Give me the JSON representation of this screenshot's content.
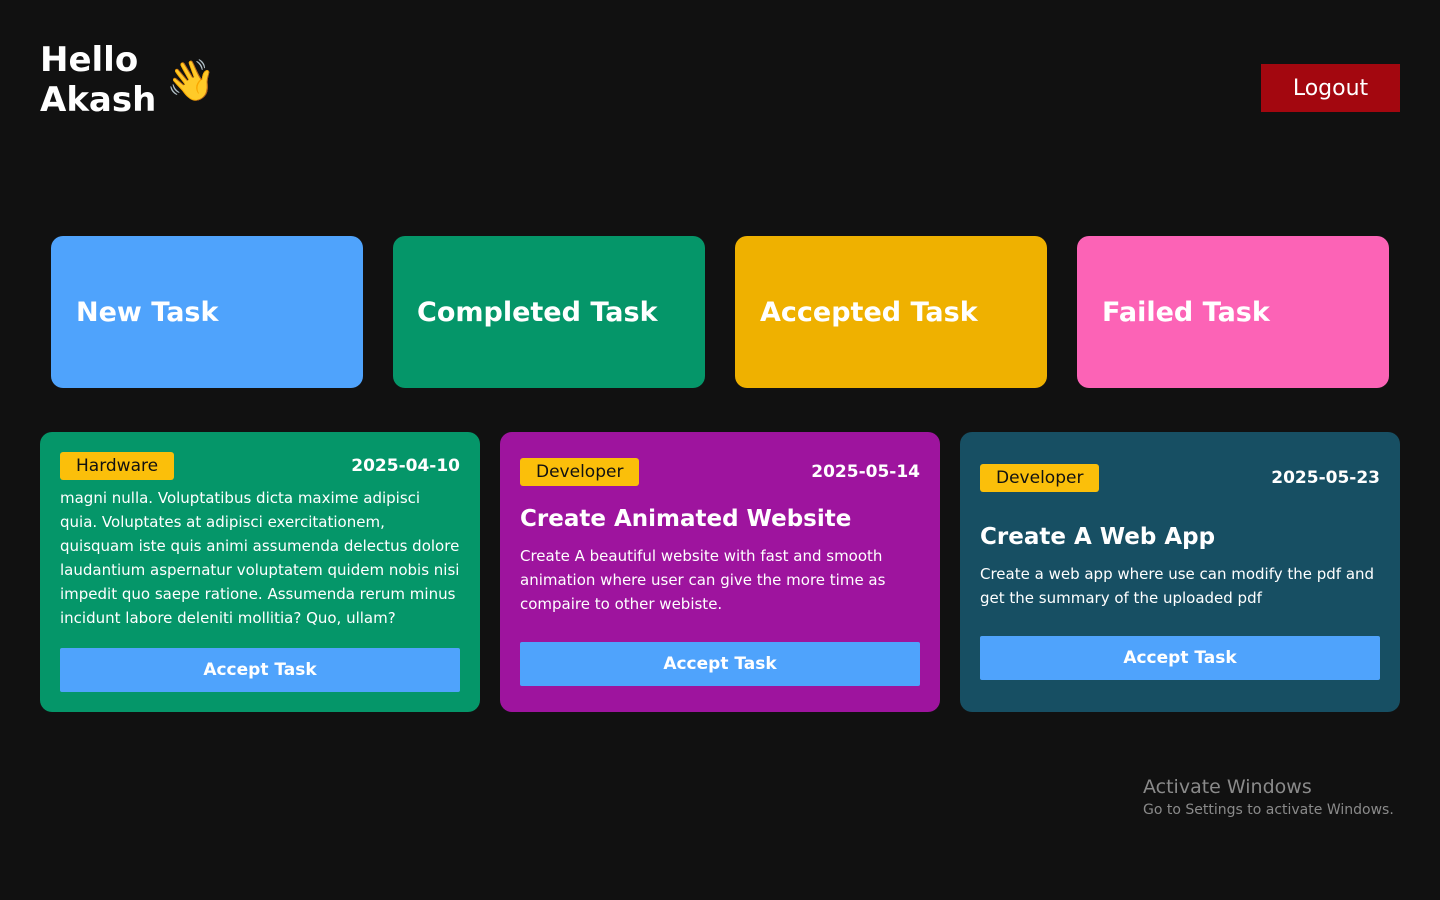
{
  "header": {
    "greeting_line1": "Hello",
    "greeting_line2": "Akash",
    "wave_emoji": "👋",
    "logout_label": "Logout"
  },
  "stats": [
    {
      "label": "New Task",
      "color": "#4fa3fc"
    },
    {
      "label": "Completed Task",
      "color": "#059669"
    },
    {
      "label": "Accepted Task",
      "color": "#efb100"
    },
    {
      "label": "Failed Task",
      "color": "#fc63b6"
    }
  ],
  "tasks": [
    {
      "category": "Hardware",
      "date": "2025-04-10",
      "title": "",
      "description": "magni nulla. Voluptatibus dicta maxime adipisci quia. Voluptates at adipisci exercitationem, quisquam iste quis animi assumenda delectus dolore laudantium aspernatur voluptatem quidem nobis nisi impedit quo saepe ratione. Assumenda rerum minus incidunt labore deleniti mollitia? Quo, ullam?",
      "button_label": "Accept Task",
      "color": "#059669"
    },
    {
      "category": "Developer",
      "date": "2025-05-14",
      "title": "Create Animated Website",
      "description": "Create A beautiful website with fast and smooth animation where user can give the more time as compaire to other webiste.",
      "button_label": "Accept Task",
      "color": "#9e149e"
    },
    {
      "category": "Developer",
      "date": "2025-05-23",
      "title": "Create A Web App",
      "description": "Create a web app where use can modify the pdf and get the summary of the uploaded pdf",
      "button_label": "Accept Task",
      "color": "#174f63"
    }
  ],
  "watermark": {
    "title": "Activate Windows",
    "subtitle": "Go to Settings to activate Windows."
  }
}
